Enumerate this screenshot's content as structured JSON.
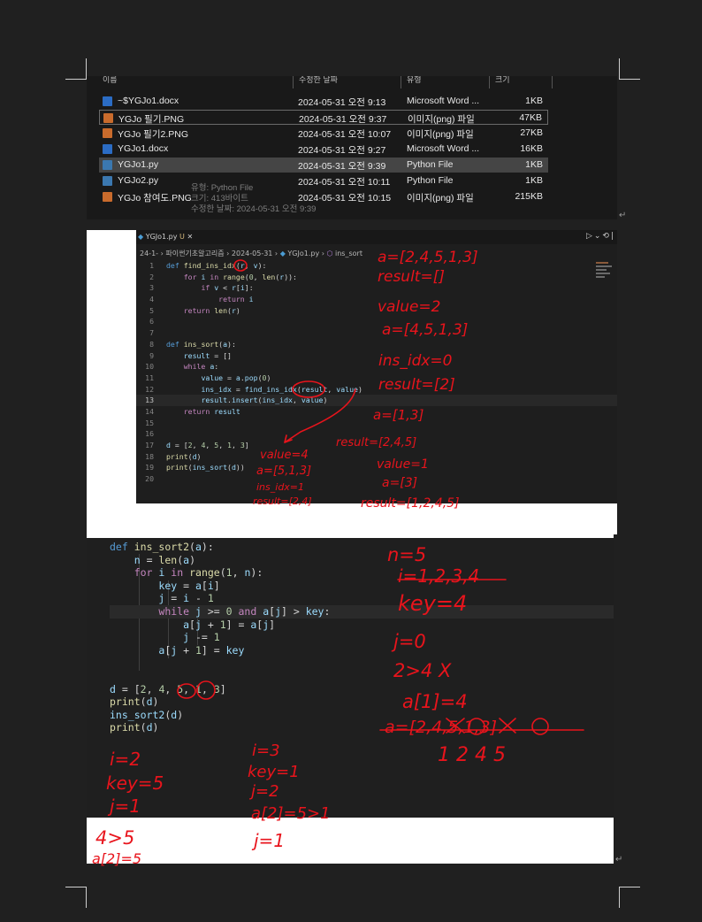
{
  "file_list": {
    "columns": [
      "이름",
      "수정한 날짜",
      "유형",
      "크기"
    ],
    "rows": [
      {
        "name": "~$YGJo1.docx",
        "date": "2024-05-31 오전 9:13",
        "type": "Microsoft Word ...",
        "size": "1KB",
        "icon": "word-doc-icon"
      },
      {
        "name": "YGJo 필기.PNG",
        "date": "2024-05-31 오전 9:37",
        "type": "이미지(png) 파일",
        "size": "47KB",
        "icon": "image-file-icon"
      },
      {
        "name": "YGJo 필기2.PNG",
        "date": "2024-05-31 오전 10:07",
        "type": "이미지(png) 파일",
        "size": "27KB",
        "icon": "image-file-icon"
      },
      {
        "name": "YGJo1.docx",
        "date": "2024-05-31 오전 9:27",
        "type": "Microsoft Word ...",
        "size": "16KB",
        "icon": "word-doc-icon"
      },
      {
        "name": "YGJo1.py",
        "date": "2024-05-31 오전 9:39",
        "type": "Python File",
        "size": "1KB",
        "icon": "python-file-icon"
      },
      {
        "name": "YGJo2.py",
        "date": "2024-05-31 오전 10:11",
        "type": "Python File",
        "size": "1KB",
        "icon": "python-file-icon"
      },
      {
        "name": "YGJo 참여도.PNG",
        "date": "2024-05-31 오전 10:15",
        "type": "이미지(png) 파일",
        "size": "215KB",
        "icon": "image-file-icon"
      }
    ],
    "tooltip": [
      "유형: Python File",
      "크기: 413바이트",
      "수정한 날짜: 2024-05-31 오전 9:39"
    ]
  },
  "editor1": {
    "tab_label": "YGJo1.py",
    "tab_status": "U",
    "breadcrumb": [
      "24-1-",
      "파이썬기초알고리즘",
      "2024-05-31",
      "YGJo1.py",
      "ins_sort"
    ],
    "current_line": 13,
    "lines": [
      "def find_ins_idx(r, v):",
      "    for i in range(0, len(r)):",
      "        if v < r[i]:",
      "            return i",
      "    return len(r)",
      "",
      "",
      "def ins_sort(a):",
      "    result = []",
      "    while a:",
      "        value = a.pop(0)",
      "        ins_idx = find_ins_idx(result, value)",
      "        result.insert(ins_idx, value)",
      "    return result",
      "",
      "",
      "d = [2, 4, 5, 1, 3]",
      "print(d)",
      "print(ins_sort(d))",
      ""
    ],
    "handwritten_notes": [
      "a=[2,4,5,1,3]",
      "result=[]",
      "value=2",
      "a=[4,5,1,3]",
      "ins_idx=0",
      "result=[2]",
      "a=[1,3]",
      "result=[2,4,5]",
      "value=1",
      "a=[3]",
      "result=[1,2,4,5]",
      "value=4",
      "a=[5,1,3]",
      "ins_idx=1",
      "result=[2,4]"
    ]
  },
  "editor2": {
    "lines": [
      "def ins_sort2(a):",
      "    n = len(a)",
      "    for i in range(1, n):",
      "        key = a[i]",
      "        j = i - 1",
      "        while j >= 0 and a[j] > key:",
      "            a[j + 1] = a[j]",
      "            j -= 1",
      "        a[j + 1] = key",
      "",
      "",
      "d = [2, 4, 5, 1, 3]",
      "print(d)",
      "ins_sort2(d)",
      "print(d)"
    ],
    "handwritten_notes": [
      "n=5",
      "i=1,2,3,4",
      "key=4",
      "j=0",
      "2>4 X",
      "a[1]=4",
      "a=[2,4,5,1,3]",
      "1 2 4 5",
      "i=2",
      "key=5",
      "j=1",
      "i=3",
      "key=1",
      "j=2",
      "a[2]=5>1",
      "j=1",
      "4>5",
      "a[2]=5"
    ]
  },
  "colors": {
    "keyword": "#c586c0",
    "def": "#569cd6",
    "function": "#dcdcaa",
    "number": "#b5cea8",
    "variable": "#9cdcfe",
    "ink": "#e8141c"
  }
}
